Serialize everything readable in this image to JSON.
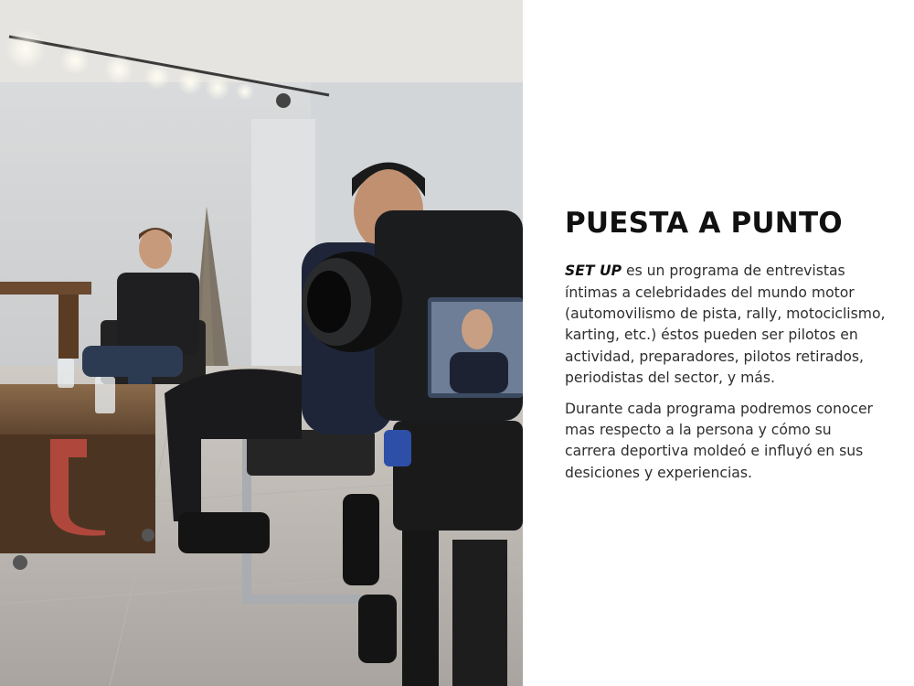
{
  "photo": {
    "description_icon": "interview-set-photo"
  },
  "section": {
    "title": "PUESTA A PUNTO",
    "p1_emphasis": "SET UP",
    "p1_text": " es un programa de entrevistas íntimas a celebridades del mundo motor (automovilismo de pista, rally, motociclismo, karting, etc.) éstos pueden ser pilotos en actividad, preparadores, pilotos retirados, periodistas del sector, y más.",
    "p2_text": "Durante cada programa podremos conocer mas respecto a la persona y cómo su carrera deportiva moldeó e influyó en sus desiciones y experiencias."
  },
  "colors": {
    "background": "#ffffff",
    "title": "#111111",
    "body_text": "#2e2e2e"
  }
}
